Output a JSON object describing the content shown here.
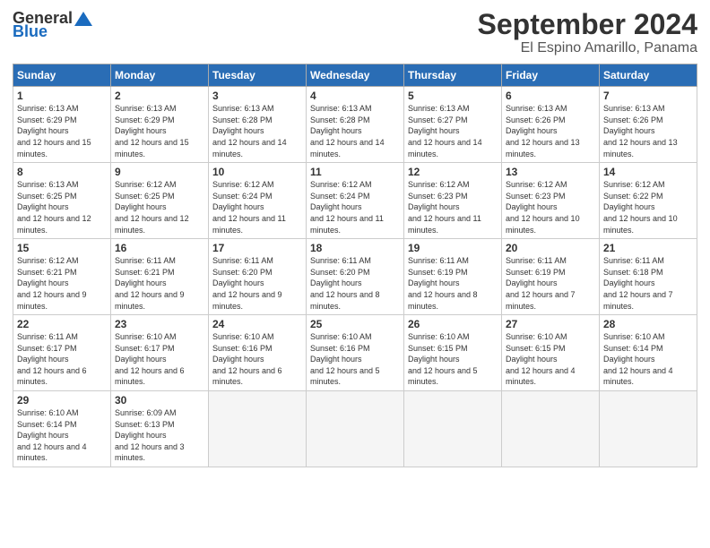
{
  "header": {
    "logo_general": "General",
    "logo_blue": "Blue",
    "month": "September 2024",
    "location": "El Espino Amarillo, Panama"
  },
  "weekdays": [
    "Sunday",
    "Monday",
    "Tuesday",
    "Wednesday",
    "Thursday",
    "Friday",
    "Saturday"
  ],
  "weeks": [
    [
      {
        "day": "1",
        "sunrise": "6:13 AM",
        "sunset": "6:29 PM",
        "daylight": "12 hours and 15 minutes."
      },
      {
        "day": "2",
        "sunrise": "6:13 AM",
        "sunset": "6:29 PM",
        "daylight": "12 hours and 15 minutes."
      },
      {
        "day": "3",
        "sunrise": "6:13 AM",
        "sunset": "6:28 PM",
        "daylight": "12 hours and 14 minutes."
      },
      {
        "day": "4",
        "sunrise": "6:13 AM",
        "sunset": "6:28 PM",
        "daylight": "12 hours and 14 minutes."
      },
      {
        "day": "5",
        "sunrise": "6:13 AM",
        "sunset": "6:27 PM",
        "daylight": "12 hours and 14 minutes."
      },
      {
        "day": "6",
        "sunrise": "6:13 AM",
        "sunset": "6:26 PM",
        "daylight": "12 hours and 13 minutes."
      },
      {
        "day": "7",
        "sunrise": "6:13 AM",
        "sunset": "6:26 PM",
        "daylight": "12 hours and 13 minutes."
      }
    ],
    [
      {
        "day": "8",
        "sunrise": "6:13 AM",
        "sunset": "6:25 PM",
        "daylight": "12 hours and 12 minutes."
      },
      {
        "day": "9",
        "sunrise": "6:12 AM",
        "sunset": "6:25 PM",
        "daylight": "12 hours and 12 minutes."
      },
      {
        "day": "10",
        "sunrise": "6:12 AM",
        "sunset": "6:24 PM",
        "daylight": "12 hours and 11 minutes."
      },
      {
        "day": "11",
        "sunrise": "6:12 AM",
        "sunset": "6:24 PM",
        "daylight": "12 hours and 11 minutes."
      },
      {
        "day": "12",
        "sunrise": "6:12 AM",
        "sunset": "6:23 PM",
        "daylight": "12 hours and 11 minutes."
      },
      {
        "day": "13",
        "sunrise": "6:12 AM",
        "sunset": "6:23 PM",
        "daylight": "12 hours and 10 minutes."
      },
      {
        "day": "14",
        "sunrise": "6:12 AM",
        "sunset": "6:22 PM",
        "daylight": "12 hours and 10 minutes."
      }
    ],
    [
      {
        "day": "15",
        "sunrise": "6:12 AM",
        "sunset": "6:21 PM",
        "daylight": "12 hours and 9 minutes."
      },
      {
        "day": "16",
        "sunrise": "6:11 AM",
        "sunset": "6:21 PM",
        "daylight": "12 hours and 9 minutes."
      },
      {
        "day": "17",
        "sunrise": "6:11 AM",
        "sunset": "6:20 PM",
        "daylight": "12 hours and 9 minutes."
      },
      {
        "day": "18",
        "sunrise": "6:11 AM",
        "sunset": "6:20 PM",
        "daylight": "12 hours and 8 minutes."
      },
      {
        "day": "19",
        "sunrise": "6:11 AM",
        "sunset": "6:19 PM",
        "daylight": "12 hours and 8 minutes."
      },
      {
        "day": "20",
        "sunrise": "6:11 AM",
        "sunset": "6:19 PM",
        "daylight": "12 hours and 7 minutes."
      },
      {
        "day": "21",
        "sunrise": "6:11 AM",
        "sunset": "6:18 PM",
        "daylight": "12 hours and 7 minutes."
      }
    ],
    [
      {
        "day": "22",
        "sunrise": "6:11 AM",
        "sunset": "6:17 PM",
        "daylight": "12 hours and 6 minutes."
      },
      {
        "day": "23",
        "sunrise": "6:10 AM",
        "sunset": "6:17 PM",
        "daylight": "12 hours and 6 minutes."
      },
      {
        "day": "24",
        "sunrise": "6:10 AM",
        "sunset": "6:16 PM",
        "daylight": "12 hours and 6 minutes."
      },
      {
        "day": "25",
        "sunrise": "6:10 AM",
        "sunset": "6:16 PM",
        "daylight": "12 hours and 5 minutes."
      },
      {
        "day": "26",
        "sunrise": "6:10 AM",
        "sunset": "6:15 PM",
        "daylight": "12 hours and 5 minutes."
      },
      {
        "day": "27",
        "sunrise": "6:10 AM",
        "sunset": "6:15 PM",
        "daylight": "12 hours and 4 minutes."
      },
      {
        "day": "28",
        "sunrise": "6:10 AM",
        "sunset": "6:14 PM",
        "daylight": "12 hours and 4 minutes."
      }
    ],
    [
      {
        "day": "29",
        "sunrise": "6:10 AM",
        "sunset": "6:14 PM",
        "daylight": "12 hours and 4 minutes."
      },
      {
        "day": "30",
        "sunrise": "6:09 AM",
        "sunset": "6:13 PM",
        "daylight": "12 hours and 3 minutes."
      },
      null,
      null,
      null,
      null,
      null
    ]
  ]
}
